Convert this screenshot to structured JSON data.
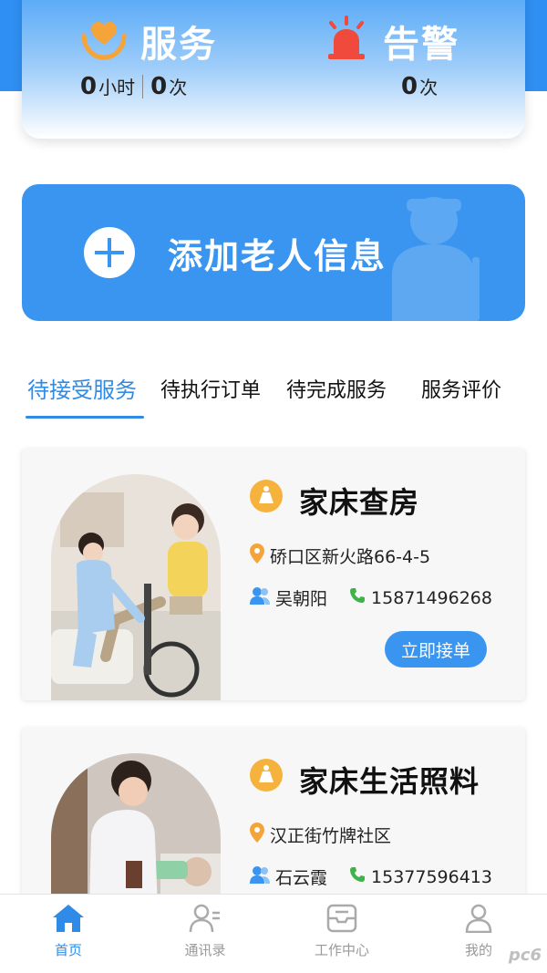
{
  "stats": {
    "service": {
      "title": "服务",
      "hours_value": "0",
      "hours_unit": "小时",
      "count_value": "0",
      "count_unit": "次"
    },
    "alarm": {
      "title": "告警",
      "count_value": "0",
      "count_unit": "次"
    }
  },
  "add_banner": {
    "label": "添加老人信息"
  },
  "tabs": [
    {
      "label": "待接受服务",
      "active": true
    },
    {
      "label": "待执行订单",
      "active": false
    },
    {
      "label": "待完成服务",
      "active": false
    },
    {
      "label": "服务评价",
      "active": false
    }
  ],
  "orders": [
    {
      "service": "家床查房",
      "address": "硚口区新火路66-4-5",
      "contact_name": "吴朝阳",
      "phone": "15871496268",
      "action_label": "立即接单"
    },
    {
      "service": "家床生活照料",
      "address": "汉正街竹牌社区",
      "contact_name": "石云霞",
      "phone": "15377596413"
    }
  ],
  "bottom_nav": [
    {
      "label": "首页",
      "icon": "home-icon",
      "active": true
    },
    {
      "label": "通讯录",
      "icon": "contacts-icon",
      "active": false
    },
    {
      "label": "工作中心",
      "icon": "work-center-icon",
      "active": false
    },
    {
      "label": "我的",
      "icon": "profile-icon",
      "active": false
    }
  ],
  "watermark": "pc6",
  "colors": {
    "primary": "#3a95f0",
    "accent_text": "#2e8be8",
    "heart": "#f5a43a",
    "alarm": "#f04a3c",
    "location": "#f5a43a",
    "phone": "#3fb24a"
  }
}
